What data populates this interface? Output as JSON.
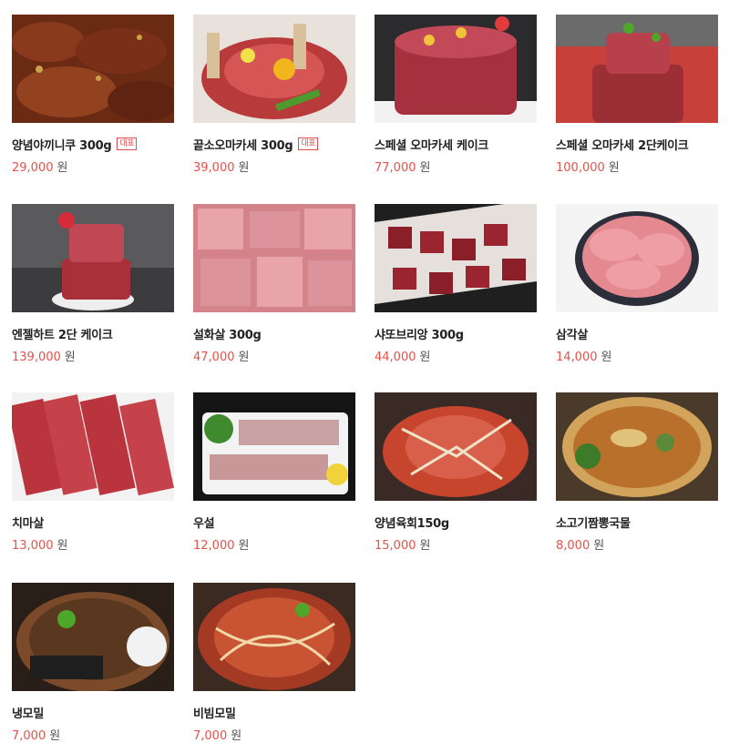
{
  "currency": "원",
  "badge_label": "대표",
  "items": [
    {
      "name": "양념야끼니쿠 300g",
      "price": "29,000",
      "badge": true
    },
    {
      "name": "끝소오마카세 300g",
      "price": "39,000",
      "badge": true
    },
    {
      "name": "스페셜 오마카세 케이크",
      "price": "77,000",
      "badge": false
    },
    {
      "name": "스페셜 오마카세 2단케이크",
      "price": "100,000",
      "badge": false
    },
    {
      "name": "엔젤하트 2단 케이크",
      "price": "139,000",
      "badge": false
    },
    {
      "name": "설화살 300g",
      "price": "47,000",
      "badge": false
    },
    {
      "name": "샤또브리앙 300g",
      "price": "44,000",
      "badge": false
    },
    {
      "name": "삼각살",
      "price": "14,000",
      "badge": false
    },
    {
      "name": "치마살",
      "price": "13,000",
      "badge": false
    },
    {
      "name": "우설",
      "price": "12,000",
      "badge": false
    },
    {
      "name": "양념육회150g",
      "price": "15,000",
      "badge": false
    },
    {
      "name": "소고기짬뽕국물",
      "price": "8,000",
      "badge": false
    },
    {
      "name": "냉모밀",
      "price": "7,000",
      "badge": false
    },
    {
      "name": "비빔모밀",
      "price": "7,000",
      "badge": false
    }
  ]
}
